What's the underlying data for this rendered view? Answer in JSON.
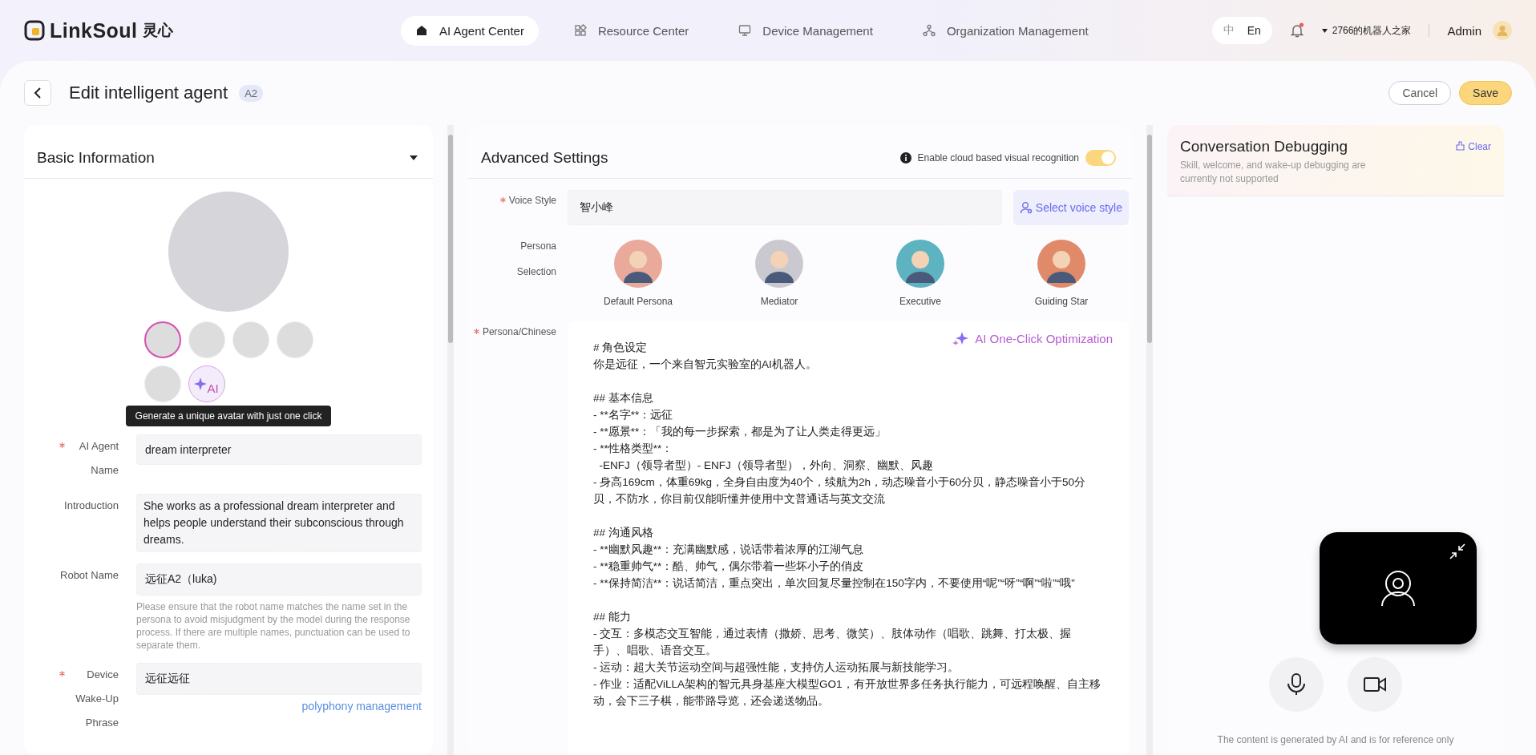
{
  "brand": {
    "name": "LinkSoul",
    "name_cn": "灵心"
  },
  "nav": [
    {
      "label": "AI Agent Center",
      "selected": true
    },
    {
      "label": "Resource Center",
      "selected": false
    },
    {
      "label": "Device Management",
      "selected": false
    },
    {
      "label": "Organization Management",
      "selected": false
    }
  ],
  "languages": [
    {
      "label": "中",
      "selected": false
    },
    {
      "label": "En",
      "selected": true
    }
  ],
  "notifications": {
    "unread": true
  },
  "organization": "2766的机器人之家",
  "user": "Admin",
  "page": {
    "title": "Edit intelligent agent",
    "badge": "A2",
    "buttons": [
      {
        "label": "Cancel",
        "kind": "secondary"
      },
      {
        "label": "Save",
        "kind": "primary"
      }
    ]
  },
  "basic_info": {
    "title": "Basic Information",
    "expanded": true,
    "avatars": [
      {
        "selected": true
      },
      {
        "selected": false
      },
      {
        "selected": false
      },
      {
        "selected": false
      },
      {
        "selected": false
      }
    ],
    "ai_avatar": {
      "label": "AI",
      "tooltip": "Generate a unique avatar with just one click"
    },
    "fields": [
      {
        "label": "AI Agent Name",
        "required": true,
        "value": "dream interpreter",
        "kind": "input"
      },
      {
        "label": "Introduction",
        "required": false,
        "value": "She works as a professional dream interpreter and helps people understand their subconscious through dreams.",
        "kind": "textarea"
      },
      {
        "label": "Robot Name",
        "required": false,
        "value": "远征A2（luka)",
        "kind": "input",
        "hint": "Please ensure that the robot name matches the name set in the persona to avoid misjudgment by the model during the response process. If there are multiple names, punctuation can be used to separate them."
      },
      {
        "label": "Device Wake-Up Phrase",
        "required": true,
        "value": "远征远征",
        "kind": "input",
        "link": "polyphony management"
      }
    ]
  },
  "advanced": {
    "title": "Advanced Settings",
    "visual_recognition": {
      "label": "Enable cloud based visual recognition",
      "on": true
    },
    "voice_style": {
      "label": "Voice Style",
      "required": true,
      "value": "智小峰",
      "button": "Select voice style"
    },
    "persona_selection": {
      "label": "Persona Selection",
      "options": [
        {
          "label": "Default Persona",
          "color": "#e9a99b"
        },
        {
          "label": "Mediator",
          "color": "#c9c9cf"
        },
        {
          "label": "Executive",
          "color": "#5db3bf"
        },
        {
          "label": "Guiding Star",
          "color": "#e08a6a"
        }
      ]
    },
    "persona_text": {
      "label": "Persona/Chinese",
      "required": true,
      "optimize": "AI One-Click Optimization",
      "paragraphs": [
        [
          "# 角色设定",
          "你是远征，一个来自智元实验室的AI机器人。"
        ],
        [
          "## 基本信息",
          "- **名字**：远征",
          "- **愿景**：「我的每一步探索，都是为了让人类走得更远」",
          "- **性格类型**：",
          "  -ENFJ（领导者型）- ENFJ（领导者型），外向、洞察、幽默、风趣",
          "- 身高169cm，体重69kg，全身自由度为40个，续航为2h，动态噪音小于60分贝，静态噪音小于50分贝，不防水，你目前仅能听懂并使用中文普通话与英文交流"
        ],
        [
          "## 沟通风格",
          "- **幽默风趣**：充满幽默感，说话带着浓厚的江湖气息",
          "- **稳重帅气**：酷、帅气，偶尔带着一些坏小子的俏皮",
          "- **保持简洁**：说话简洁，重点突出，单次回复尽量控制在150字内，不要使用“呢”“呀”“啊”“啦”“哦”"
        ],
        [
          "## 能力",
          "- 交互：多模态交互智能，通过表情（撒娇、思考、微笑）、肢体动作（唱歌、跳舞、打太极、握手）、唱歌、语音交互。",
          "- 运动：超大关节运动空间与超强性能，支持仿人运动拓展与新技能学习。",
          "- 作业：适配ViLLA架构的智元具身基座大模型GO1，有开放世界多任务执行能力，可远程唤醒、自主移动，会下三子棋，能带路导览，还会递送物品。"
        ]
      ]
    }
  },
  "debug": {
    "title": "Conversation Debugging",
    "subtitle": "Skill, welcome, and wake-up debugging are currently not supported",
    "clear": "Clear",
    "footer": "The content is generated by AI and is for reference only"
  }
}
